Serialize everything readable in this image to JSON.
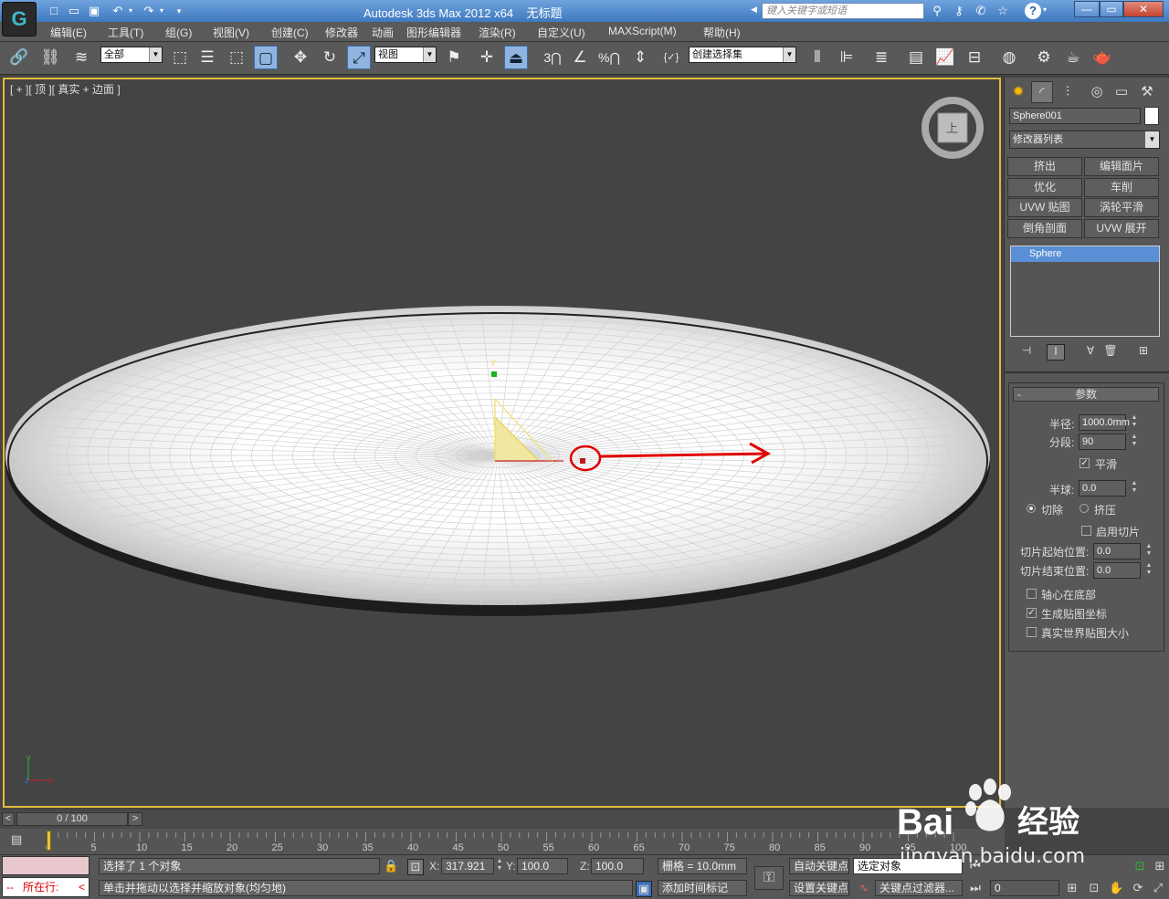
{
  "window": {
    "title": "Autodesk 3ds Max  2012 x64",
    "document": "无标题",
    "search_placeholder": "键入关键字或短语",
    "minimize": "—",
    "maximize": "▭",
    "close": "✕",
    "help": "?"
  },
  "quick_access": [
    "□",
    "📂",
    "💾",
    "↶",
    "↷",
    "▾"
  ],
  "menu": [
    "编辑(E)",
    "工具(T)",
    "组(G)",
    "视图(V)",
    "创建(C)",
    "修改器",
    "动画",
    "图形编辑器",
    "渲染(R)",
    "自定义(U)",
    "MAXScript(M)",
    "帮助(H)"
  ],
  "toolbar": {
    "selection_filter": "全部",
    "ref_coord": "视图",
    "named_selection": "创建选择集"
  },
  "viewport": {
    "label": "[ + ][ 顶 ][ 真实 + 边面 ]",
    "viewcube_face": "上",
    "gizmo_y": "y",
    "axis_x": "x",
    "axis_y": "y",
    "axis_z": "z"
  },
  "command_panel": {
    "object_name": "Sphere001",
    "modifier_list": "修改器列表",
    "modifier_buttons": [
      "挤出",
      "编辑面片",
      "优化",
      "车削",
      "UVW 贴图",
      "涡轮平滑",
      "倒角剖面",
      "UVW 展开"
    ],
    "stack_item": "Sphere",
    "params_title": "参数",
    "radius_label": "半径:",
    "radius": "1000.0mm",
    "segments_label": "分段:",
    "segments": "90",
    "smooth_label": "平滑",
    "smooth": true,
    "hemisphere_label": "半球:",
    "hemisphere": "0.0",
    "chop_label": "切除",
    "squash_label": "挤压",
    "slice_on_label": "启用切片",
    "slice_from_label": "切片起始位置:",
    "slice_from": "0.0",
    "slice_to_label": "切片结束位置:",
    "slice_to": "0.0",
    "base_pivot_label": "轴心在底部",
    "gen_map_label": "生成贴图坐标",
    "real_world_label": "真实世界贴图大小"
  },
  "timeline": {
    "frame": "0 / 100",
    "prev": "<",
    "next": ">",
    "ticks": [
      "0",
      "5",
      "10",
      "15",
      "20",
      "25",
      "30",
      "35",
      "40",
      "45",
      "50",
      "55",
      "60",
      "65",
      "70",
      "75",
      "80",
      "85",
      "90",
      "95",
      "100"
    ]
  },
  "status": {
    "selected": "选择了 1 个对象",
    "prompt": "单击并拖动以选择并缩放对象(均匀地)",
    "location": "所在行:",
    "x_label": "X:",
    "x": "317.921",
    "y_label": "Y:",
    "y": "100.0",
    "z_label": "Z:",
    "z": "100.0",
    "grid": "栅格 = 10.0mm",
    "auto_key": "自动关键点",
    "set_key": "设置关键点",
    "key_mode": "选定对象",
    "key_filters": "关键点过滤器...",
    "add_time_tag": "添加时间标记",
    "frame_input": "0"
  },
  "watermark": {
    "brand": "Bai",
    "brand_cn": "经验",
    "url": "jingyan.baidu.com"
  }
}
